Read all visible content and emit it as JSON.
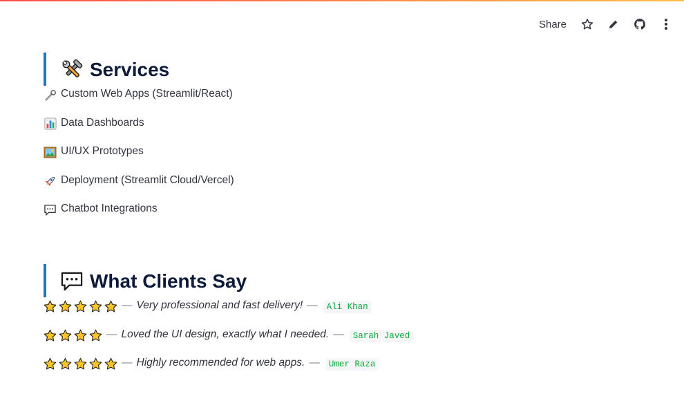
{
  "toolbar": {
    "share_label": "Share",
    "icons": [
      "star-icon",
      "pencil-icon",
      "github-icon",
      "more-vertical-icon"
    ]
  },
  "services": {
    "title": "Services",
    "title_icon": "tools-icon",
    "items": [
      {
        "icon": "wrench-icon",
        "label": "Custom Web Apps (Streamlit/React)"
      },
      {
        "icon": "bar-chart-icon",
        "label": "Data Dashboards"
      },
      {
        "icon": "framed-picture-icon",
        "label": "UI/UX Prototypes"
      },
      {
        "icon": "rocket-icon",
        "label": "Deployment (Streamlit Cloud/Vercel)"
      },
      {
        "icon": "speech-bubble-icon",
        "label": "Chatbot Integrations"
      }
    ]
  },
  "testimonials": {
    "title": "What Clients Say",
    "title_icon": "speech-bubble-icon",
    "items": [
      {
        "stars": 5,
        "quote": "Very professional and fast delivery!",
        "name": "Ali Khan"
      },
      {
        "stars": 4,
        "quote": "Loved the UI design, exactly what I needed.",
        "name": "Sarah Javed"
      },
      {
        "stars": 5,
        "quote": "Highly recommended for web apps.",
        "name": "Umer Raza"
      }
    ]
  },
  "colors": {
    "accent_bar": "#1f77b4",
    "heading": "#0e1a3a",
    "star_fill": "#f7c325",
    "name_text": "#09ab3b"
  }
}
